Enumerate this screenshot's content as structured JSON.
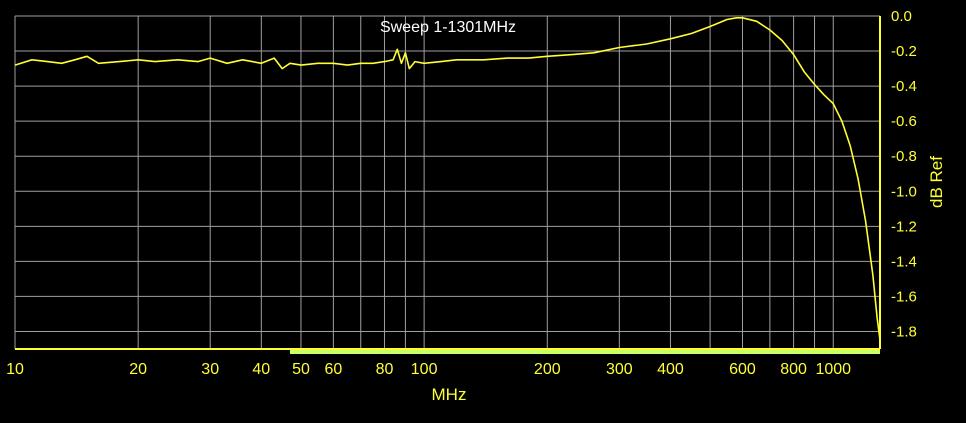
{
  "chart_data": {
    "type": "line",
    "title": "Sweep 1-1301MHz",
    "xlabel": "MHz",
    "ylabel": "dB Ref",
    "x_scale": "log",
    "xlim": [
      10,
      1301
    ],
    "ylim": [
      -1.9,
      0.0
    ],
    "x_ticks": [
      "10",
      "20",
      "30",
      "40",
      "50",
      "60",
      "80",
      "100",
      "200",
      "300",
      "400",
      "600",
      "800",
      "1000"
    ],
    "y_ticks": [
      "0.0",
      "-0.2",
      "-0.4",
      "-0.6",
      "-0.8",
      "-1.0",
      "-1.2",
      "-1.4",
      "-1.6",
      "-1.8"
    ],
    "grid": true,
    "colors": {
      "background": "#000000",
      "grid": "#a0a0a0",
      "trace": "#ffff33",
      "axis_text": "#ffff33",
      "title_text": "#ffffff",
      "band": "#ccff66"
    },
    "series": [
      {
        "x": [
          10,
          11,
          12,
          13,
          14,
          15,
          16,
          18,
          20,
          22,
          25,
          28,
          30,
          33,
          36,
          40,
          43,
          45,
          47,
          50,
          55,
          60,
          65,
          70,
          75,
          80,
          84,
          86,
          88,
          90,
          92,
          95,
          100,
          110,
          120,
          140,
          160,
          180,
          200,
          230,
          260,
          300,
          350,
          400,
          450,
          500,
          550,
          580,
          600,
          650,
          700,
          750,
          800,
          850,
          900,
          950,
          1000,
          1050,
          1100,
          1150,
          1200,
          1250,
          1280,
          1301
        ],
        "y": [
          -0.28,
          -0.25,
          -0.26,
          -0.27,
          -0.25,
          -0.23,
          -0.27,
          -0.26,
          -0.25,
          -0.26,
          -0.25,
          -0.26,
          -0.24,
          -0.27,
          -0.25,
          -0.27,
          -0.24,
          -0.3,
          -0.27,
          -0.28,
          -0.27,
          -0.27,
          -0.28,
          -0.27,
          -0.27,
          -0.26,
          -0.25,
          -0.19,
          -0.27,
          -0.21,
          -0.3,
          -0.26,
          -0.27,
          -0.26,
          -0.25,
          -0.25,
          -0.24,
          -0.24,
          -0.23,
          -0.22,
          -0.21,
          -0.18,
          -0.16,
          -0.13,
          -0.1,
          -0.06,
          -0.02,
          -0.01,
          -0.01,
          -0.03,
          -0.08,
          -0.14,
          -0.22,
          -0.32,
          -0.39,
          -0.45,
          -0.5,
          -0.6,
          -0.74,
          -0.93,
          -1.17,
          -1.48,
          -1.72,
          -1.85
        ]
      }
    ]
  }
}
